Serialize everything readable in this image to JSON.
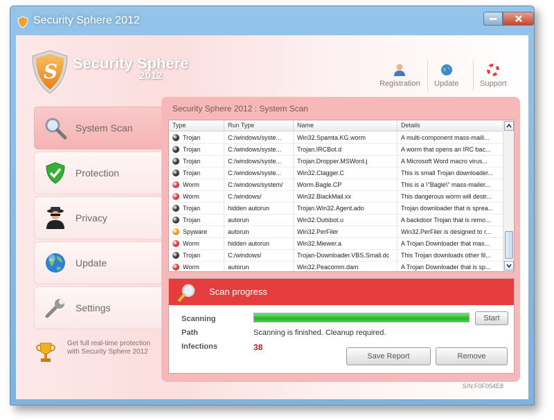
{
  "window": {
    "title": "Security Sphere 2012"
  },
  "logo": {
    "name": "Security Sphere",
    "year": "2012"
  },
  "top_actions": [
    {
      "label": "Registration",
      "icon": "person-icon"
    },
    {
      "label": "Update",
      "icon": "globe-icon"
    },
    {
      "label": "Support",
      "icon": "lifebuoy-icon"
    }
  ],
  "nav": [
    {
      "label": "System Scan",
      "icon": "magnifier-icon",
      "active": true
    },
    {
      "label": "Protection",
      "icon": "shield-check-icon",
      "active": false
    },
    {
      "label": "Privacy",
      "icon": "spy-icon",
      "active": false
    },
    {
      "label": "Update",
      "icon": "globe-icon",
      "active": false
    },
    {
      "label": "Settings",
      "icon": "wrench-icon",
      "active": false
    }
  ],
  "promo": {
    "text": "Get full real-time protection with Security Sphere 2012"
  },
  "panel": {
    "title": "Security Sphere 2012 : System Scan"
  },
  "table": {
    "columns": [
      "Type",
      "Run Type",
      "Name",
      "Details"
    ],
    "rows": [
      {
        "type": "Trojan",
        "severity": "dark",
        "run_type": "C:/windows/syste...",
        "name": "Win32.Spamta.KG.worm",
        "details": "A multi-component mass-maili..."
      },
      {
        "type": "Trojan",
        "severity": "dark",
        "run_type": "C:/windows/syste...",
        "name": "Trojan.IRCBot.d",
        "details": "A worm that opens an IRC bac..."
      },
      {
        "type": "Trojan",
        "severity": "dark",
        "run_type": "C:/windows/syste...",
        "name": "Trojan.Dropper.MSWord.j",
        "details": "A Microsoft Word macro virus..."
      },
      {
        "type": "Trojan",
        "severity": "dark",
        "run_type": "C:/windows/syste...",
        "name": "Win32.Clagger.C",
        "details": "This is small Trojan downloader..."
      },
      {
        "type": "Worm",
        "severity": "red",
        "run_type": "C:/windows/system/",
        "name": "Worm.Bagle.CP",
        "details": "This is a \\\"Bagle\\\" mass-mailer..."
      },
      {
        "type": "Worm",
        "severity": "red",
        "run_type": "C:/windows/",
        "name": "Win32.BlackMail.xx",
        "details": "This dangerous worm will destr..."
      },
      {
        "type": "Trojan",
        "severity": "dark",
        "run_type": "hidden autorun",
        "name": "Trojan.Win32.Agent.ado",
        "details": "Trojan downloader that is sprea..."
      },
      {
        "type": "Trojan",
        "severity": "dark",
        "run_type": "autorun",
        "name": "Win32.Outsbot.u",
        "details": "A backdoor Trojan that is remo..."
      },
      {
        "type": "Spyware",
        "severity": "orange",
        "run_type": "autorun",
        "name": "Win32.PerFiler",
        "details": "Win32.PerFiler is designed to r..."
      },
      {
        "type": "Worm",
        "severity": "red",
        "run_type": "hidden autorun",
        "name": "Win32.Miewer.a",
        "details": "A Trojan Downloader that mas..."
      },
      {
        "type": "Trojan",
        "severity": "dark",
        "run_type": "C:/windows/",
        "name": "Trojan-Downloader.VBS.Small.dc",
        "details": "This Trojan downloads other fil..."
      },
      {
        "type": "Worm",
        "severity": "red",
        "run_type": "autorun",
        "name": "Win32.Peacomm.dam",
        "details": "A Trojan Downloader that is sp..."
      }
    ]
  },
  "scan": {
    "title": "Scan progress",
    "scanning_label": "Scanning",
    "path_label": "Path",
    "infections_label": "Infections",
    "path_value": "Scanning is finished. Cleanup required.",
    "infections_value": "38",
    "progress_fraction": 1.0,
    "start_label": "Start",
    "save_report_label": "Save Report",
    "remove_label": "Remove"
  },
  "serial": "S/N:F0F054E8",
  "colors": {
    "accent": "#e53d3d",
    "panel": "#f6b8b8",
    "progress": "#26b526",
    "infections": "#c21f1f"
  }
}
